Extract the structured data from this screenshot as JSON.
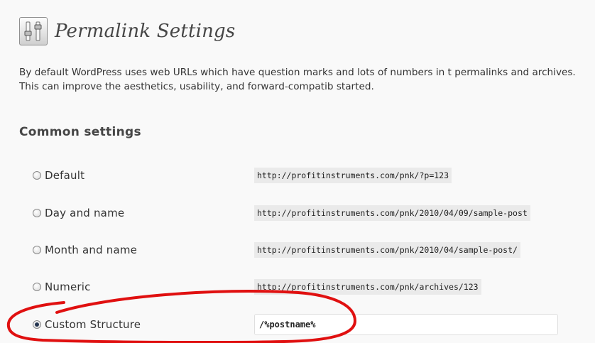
{
  "page": {
    "title": "Permalink Settings",
    "settings_icon": "settings-sliders-icon",
    "intro": "By default WordPress uses web URLs which have question marks and lots of numbers in t permalinks and archives. This can improve the aesthetics, usability, and forward-compatib started."
  },
  "common_settings": {
    "heading": "Common settings",
    "options": [
      {
        "label": "Default",
        "example": "http://profitinstruments.com/pnk/?p=123",
        "checked": false
      },
      {
        "label": "Day and name",
        "example": "http://profitinstruments.com/pnk/2010/04/09/sample-post",
        "checked": false
      },
      {
        "label": "Month and name",
        "example": "http://profitinstruments.com/pnk/2010/04/sample-post/",
        "checked": false
      },
      {
        "label": "Numeric",
        "example": "http://profitinstruments.com/pnk/archives/123",
        "checked": false
      }
    ],
    "custom": {
      "label": "Custom Structure",
      "value": "/%postname%",
      "checked": true
    }
  },
  "colors": {
    "highlight_ring": "#e01010",
    "code_bg": "#eaeaea",
    "page_bg": "#f9f9f9"
  }
}
